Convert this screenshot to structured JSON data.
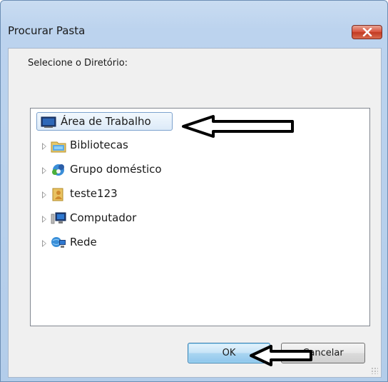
{
  "dialog": {
    "title": "Procurar Pasta",
    "instruction": "Selecione o Diretório:",
    "tree_items": [
      {
        "label": "Área de Trabalho",
        "icon": "desktop-icon",
        "selected": true
      },
      {
        "label": "Bibliotecas",
        "icon": "libraries-icon"
      },
      {
        "label": "Grupo doméstico",
        "icon": "homegroup-icon"
      },
      {
        "label": "teste123",
        "icon": "user-folder-icon"
      },
      {
        "label": "Computador",
        "icon": "computer-icon"
      },
      {
        "label": "Rede",
        "icon": "network-icon"
      }
    ],
    "ok_label": "OK",
    "cancel_label": "Cancelar"
  },
  "colors": {
    "window_frame": "#b3cdea",
    "close_button": "#c23a22",
    "ok_button": "#a9d5f1",
    "annotation_arrow": "#000000"
  }
}
